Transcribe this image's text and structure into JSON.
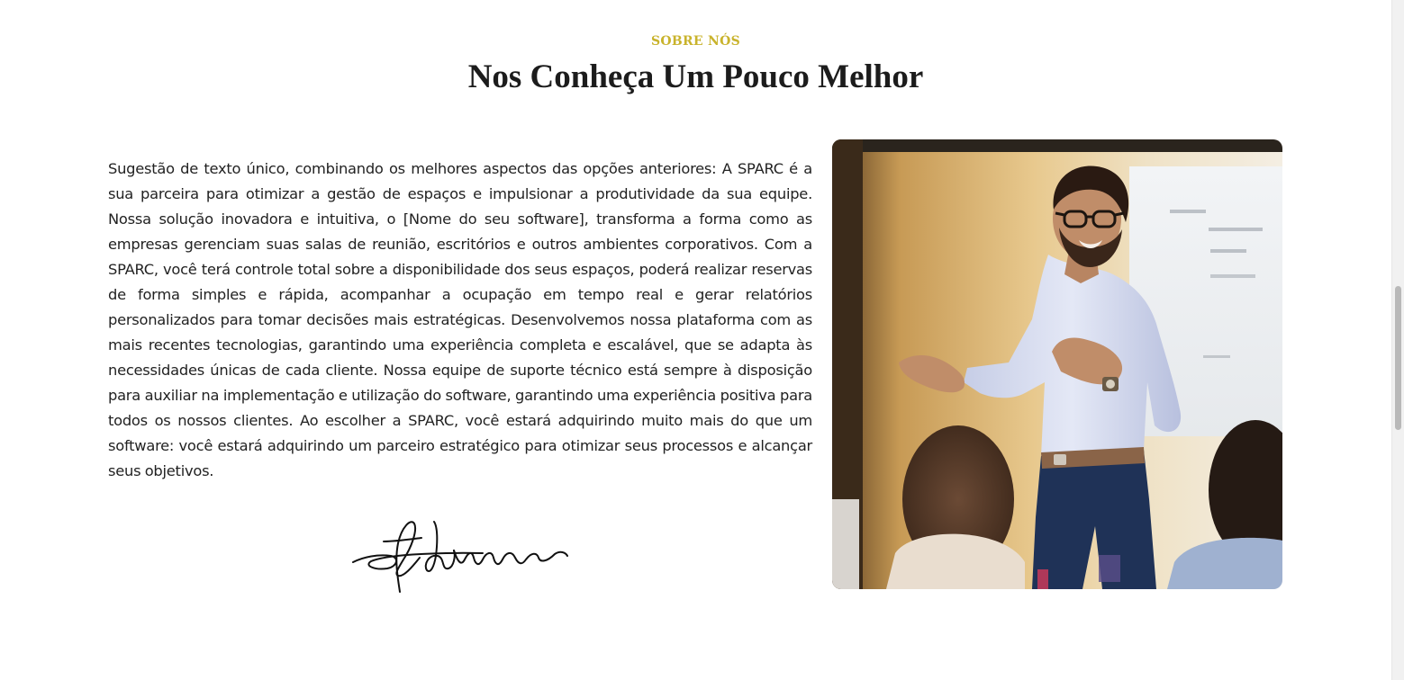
{
  "about": {
    "eyebrow": "SOBRE NÓS",
    "title": "Nos Conheça Um Pouco Melhor",
    "body": "Sugestão de texto único, combinando os melhores aspectos das opções anteriores: A SPARC é a sua parceira para otimizar a gestão de espaços e impulsionar a produtividade da sua equipe. Nossa solução inovadora e intuitiva, o [Nome do seu software], transforma a forma como as empresas gerenciam suas salas de reunião, escritórios e outros ambientes corporativos. Com a SPARC, você terá controle total sobre a disponibilidade dos seus espaços, poderá realizar reservas de forma simples e rápida, acompanhar a ocupação em tempo real e gerar relatórios personalizados para tomar decisões mais estratégicas. Desenvolvemos nossa plataforma com as mais recentes tecnologias, garantindo uma experiência completa e escalável, que se adapta às necessidades únicas de cada cliente. Nossa equipe de suporte técnico está sempre à disposição para auxiliar na implementação e utilização do software, garantindo uma experiência positiva para todos os nossos clientes. Ao escolher a SPARC, você estará adquirindo muito mais do que um software: você estará adquirindo um parceiro estratégico para otimizar seus processos e alcançar seus objetivos."
  },
  "colors": {
    "accent": "#c9b32c",
    "heading": "#1c1c1c",
    "text": "#222222",
    "background": "#ffffff"
  },
  "media": {
    "signature": "handwritten-signature",
    "photo": "presenter-speaking-photo"
  }
}
